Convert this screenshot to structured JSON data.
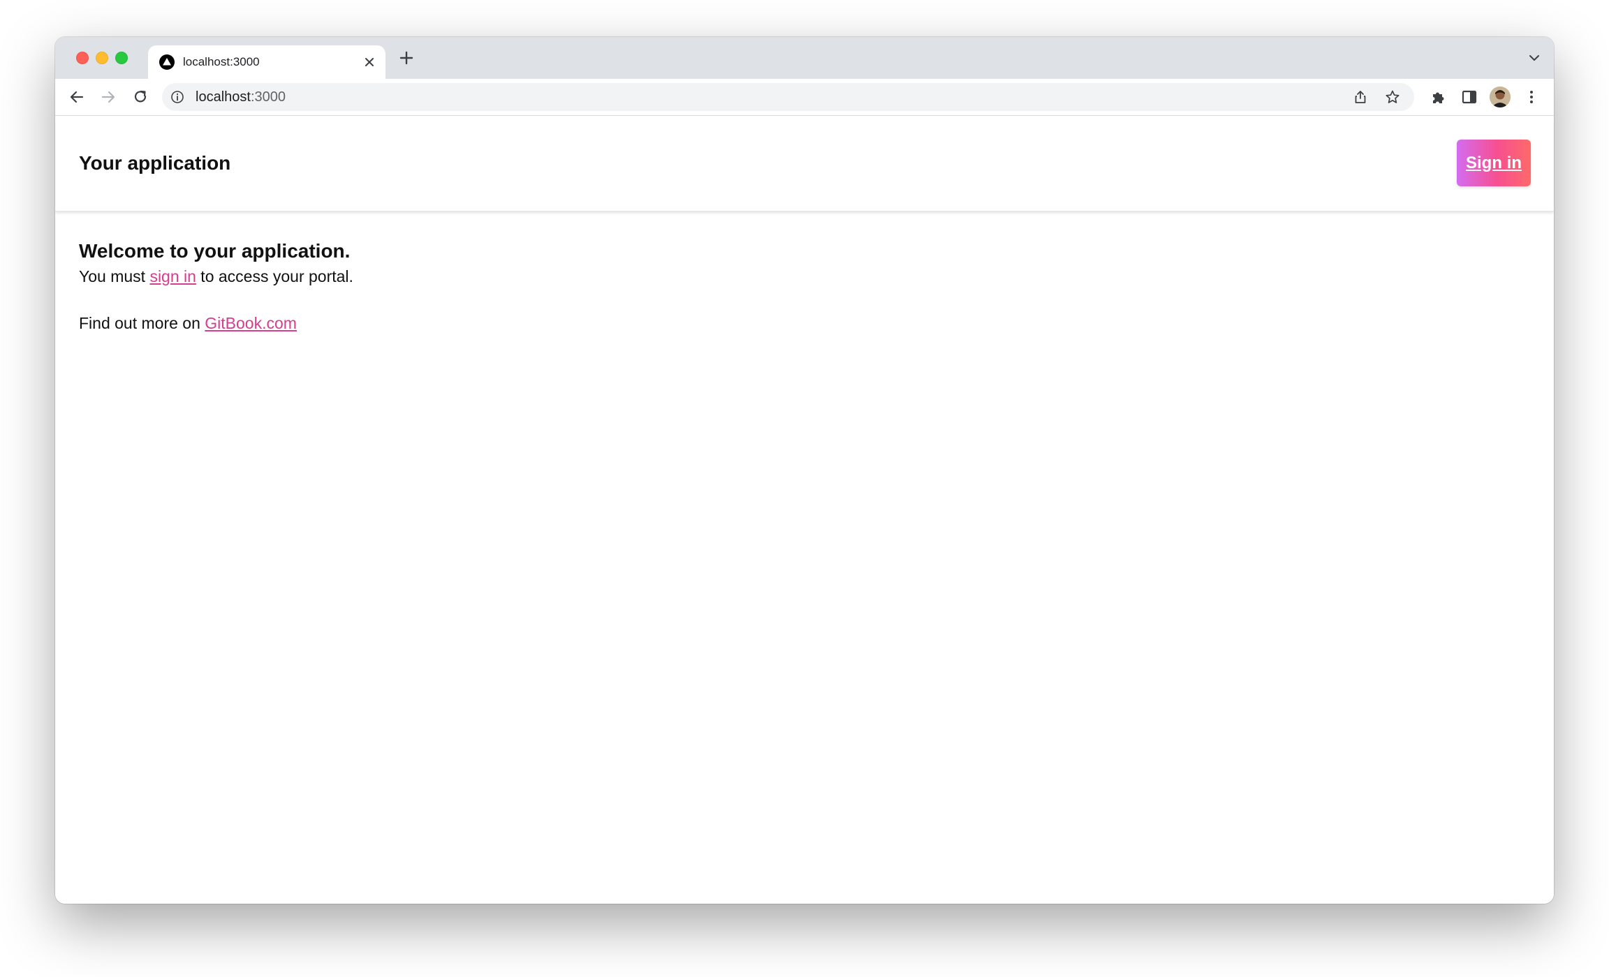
{
  "browser": {
    "tab": {
      "title": "localhost:3000"
    },
    "omnibox": {
      "host": "localhost",
      "port": ":3000"
    },
    "icons": [
      "favicon-icon",
      "close-icon",
      "plus-icon",
      "chevron-down-icon",
      "back-arrow-icon",
      "forward-arrow-icon",
      "reload-icon",
      "info-icon",
      "share-icon",
      "star-icon",
      "puzzle-icon",
      "side-panel-icon",
      "kebab-menu-icon"
    ]
  },
  "app": {
    "header": {
      "title": "Your application",
      "signin_label": "Sign in"
    },
    "main": {
      "heading": "Welcome to your application.",
      "line_prefix": "You must ",
      "line_link": "sign in",
      "line_suffix": " to access your portal.",
      "findout_prefix": "Find out more on ",
      "findout_link": "GitBook.com"
    },
    "colors": {
      "accent_link": "#d63c8f",
      "button_gradient_start": "#d36cf0",
      "button_gradient_end": "#fd6a6a"
    }
  }
}
